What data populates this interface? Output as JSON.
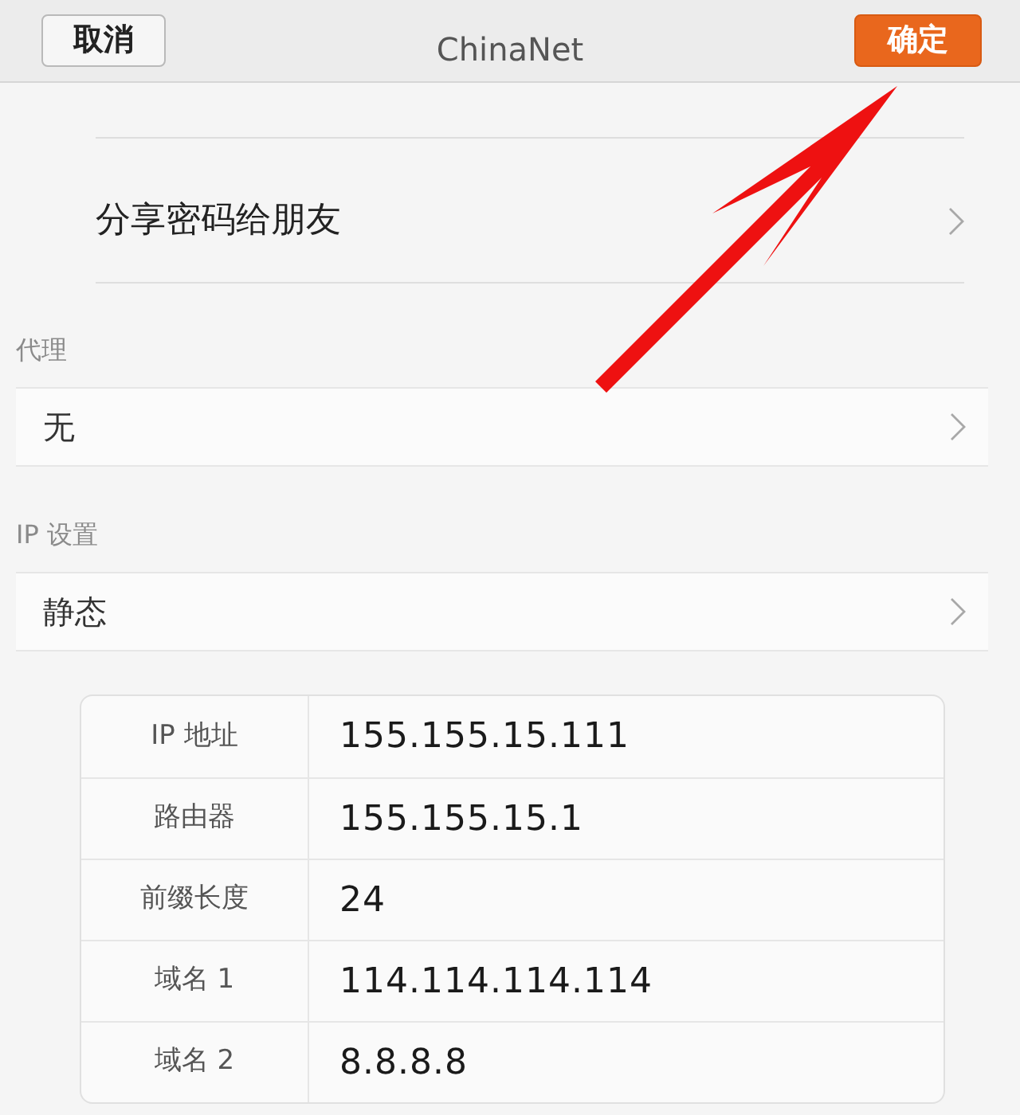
{
  "header": {
    "cancel": "取消",
    "title": "ChinaNet",
    "confirm": "确定"
  },
  "rows": [
    {
      "kind": "link",
      "label": "分享密码给朋友"
    }
  ],
  "sections": [
    {
      "title": "代理",
      "value": "无"
    },
    {
      "title": "IP 设置",
      "value": "静态"
    }
  ],
  "static_ip": [
    {
      "label": "IP 地址",
      "value": "155.155.15.111"
    },
    {
      "label": "路由器",
      "value": "155.155.15.1"
    },
    {
      "label": "前缀长度",
      "value": "24"
    },
    {
      "label": "域名 1",
      "value": "114.114.114.114"
    },
    {
      "label": "域名 2",
      "value": "8.8.8.8"
    }
  ]
}
